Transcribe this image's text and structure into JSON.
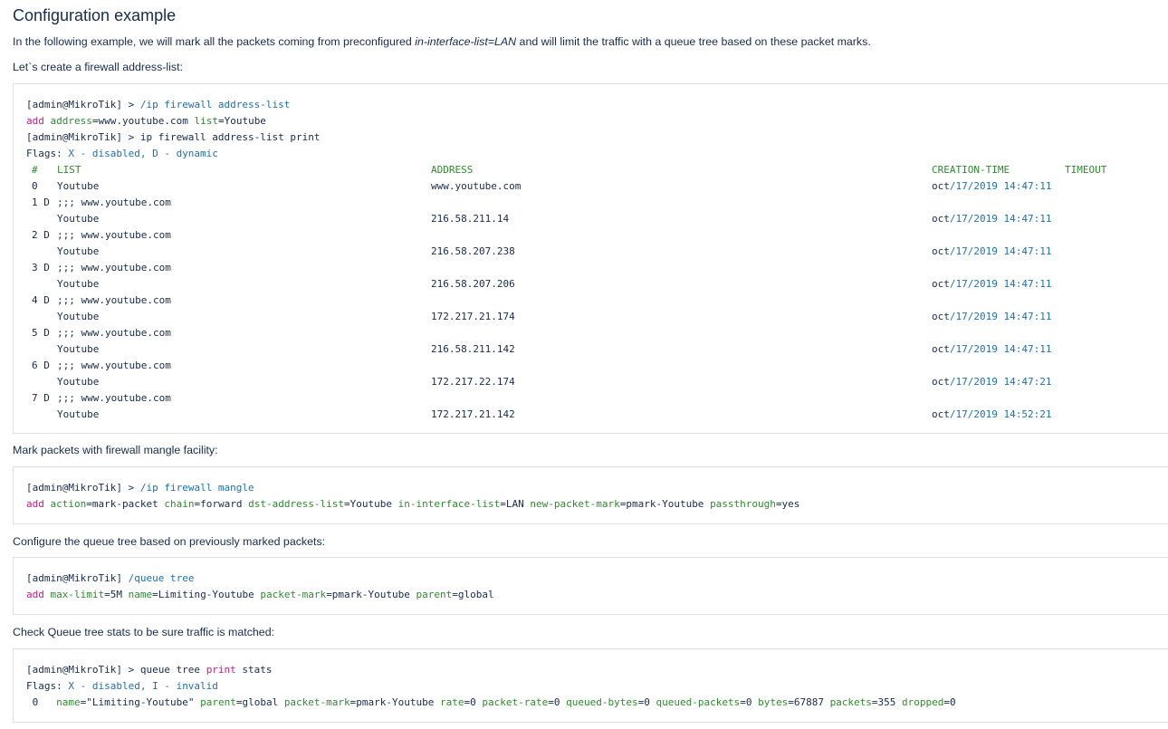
{
  "heading": "Configuration example",
  "intro": {
    "before": "In the following example, we will mark all the packets coming from preconfigured ",
    "em": "in-interface-list=LAN",
    "after": " and will limit the traffic with a queue tree based on these packet marks."
  },
  "step1": "Let`s create a firewall address-list:",
  "block1": {
    "prompt1": "[admin@MikroTik] > ",
    "cmd1": "/ip firewall address-list",
    "add_kw": "add",
    "attr_address": "address",
    "val_address": "=www.youtube.com ",
    "attr_list": "list",
    "val_list": "=Youtube",
    "prompt2": "[admin@MikroTik] > ip firewall address-list print",
    "flags_label": "Flags: ",
    "flags_text": "X - disabled, D - dynamic",
    "headers": [
      "#",
      "LIST",
      "ADDRESS",
      "CREATION-TIME",
      "TIMEOUT"
    ],
    "rows": [
      {
        "num": "0",
        "list": "Youtube",
        "comment": "",
        "address": "www.youtube.com",
        "date_prefix": "oct",
        "date_rest": "/17/2019 14:47:11"
      },
      {
        "num": "1 D",
        "list": "Youtube",
        "comment": ";;; www.youtube.com",
        "address": "216.58.211.14",
        "date_prefix": "oct",
        "date_rest": "/17/2019 14:47:11"
      },
      {
        "num": "2 D",
        "list": "Youtube",
        "comment": ";;; www.youtube.com",
        "address": "216.58.207.238",
        "date_prefix": "oct",
        "date_rest": "/17/2019 14:47:11"
      },
      {
        "num": "3 D",
        "list": "Youtube",
        "comment": ";;; www.youtube.com",
        "address": "216.58.207.206",
        "date_prefix": "oct",
        "date_rest": "/17/2019 14:47:11"
      },
      {
        "num": "4 D",
        "list": "Youtube",
        "comment": ";;; www.youtube.com",
        "address": "172.217.21.174",
        "date_prefix": "oct",
        "date_rest": "/17/2019 14:47:11"
      },
      {
        "num": "5 D",
        "list": "Youtube",
        "comment": ";;; www.youtube.com",
        "address": "216.58.211.142",
        "date_prefix": "oct",
        "date_rest": "/17/2019 14:47:11"
      },
      {
        "num": "6 D",
        "list": "Youtube",
        "comment": ";;; www.youtube.com",
        "address": "172.217.22.174",
        "date_prefix": "oct",
        "date_rest": "/17/2019 14:47:21"
      },
      {
        "num": "7 D",
        "list": "Youtube",
        "comment": ";;; www.youtube.com",
        "address": "172.217.21.142",
        "date_prefix": "oct",
        "date_rest": "/17/2019 14:52:21"
      }
    ]
  },
  "step2": "Mark packets with firewall mangle facility:",
  "block2": {
    "prompt": "[admin@MikroTik] > ",
    "cmd": "/ip firewall mangle",
    "add_kw": "add",
    "parts": [
      {
        "attr": "action",
        "val": "=mark-packet "
      },
      {
        "attr": "chain",
        "val": "=forward "
      },
      {
        "attr": "dst-address-list",
        "val": "=Youtube "
      },
      {
        "attr": "in-interface-list",
        "val": "=LAN "
      },
      {
        "attr": "new-packet-mark",
        "val": "=pmark-Youtube "
      },
      {
        "attr": "passthrough",
        "val": "=yes"
      }
    ]
  },
  "step3": "Configure the queue tree based on previously marked packets:",
  "block3": {
    "prompt": "[admin@MikroTik] ",
    "cmd": "/queue tree",
    "add_kw": "add",
    "parts": [
      {
        "attr": "max-limit",
        "val": "=5M "
      },
      {
        "attr": "name",
        "val": "=Limiting-Youtube "
      },
      {
        "attr": "packet-mark",
        "val": "=pmark-Youtube "
      },
      {
        "attr": "parent",
        "val": "=global"
      }
    ]
  },
  "step4": "Check Queue tree stats to be sure traffic is matched:",
  "block4": {
    "prompt": "[admin@MikroTik] > queue tree ",
    "print_kw": "print",
    "stats": " stats",
    "flags_label": "Flags: ",
    "flags_text": "X - disabled, I - invalid",
    "row_num": " 0   ",
    "parts": [
      {
        "attr": "name",
        "val": "=\"Limiting-Youtube\" "
      },
      {
        "attr": "parent",
        "val": "=global "
      },
      {
        "attr": "packet-mark",
        "val": "=pmark-Youtube "
      },
      {
        "attr": "rate",
        "val": "=0 "
      },
      {
        "attr": "packet-rate",
        "val": "=0 "
      },
      {
        "attr": "queued-bytes",
        "val": "=0 "
      },
      {
        "attr": "queued-packets",
        "val": "=0 "
      },
      {
        "attr": "bytes",
        "val": "=67887 "
      },
      {
        "attr": "packets",
        "val": "=355 "
      },
      {
        "attr": "dropped",
        "val": "=0"
      }
    ]
  },
  "colors": {
    "keyword": "#1d6fb8",
    "attribute": "#2e8b2e",
    "command": "#c51b8a",
    "text": "#172b4d"
  }
}
